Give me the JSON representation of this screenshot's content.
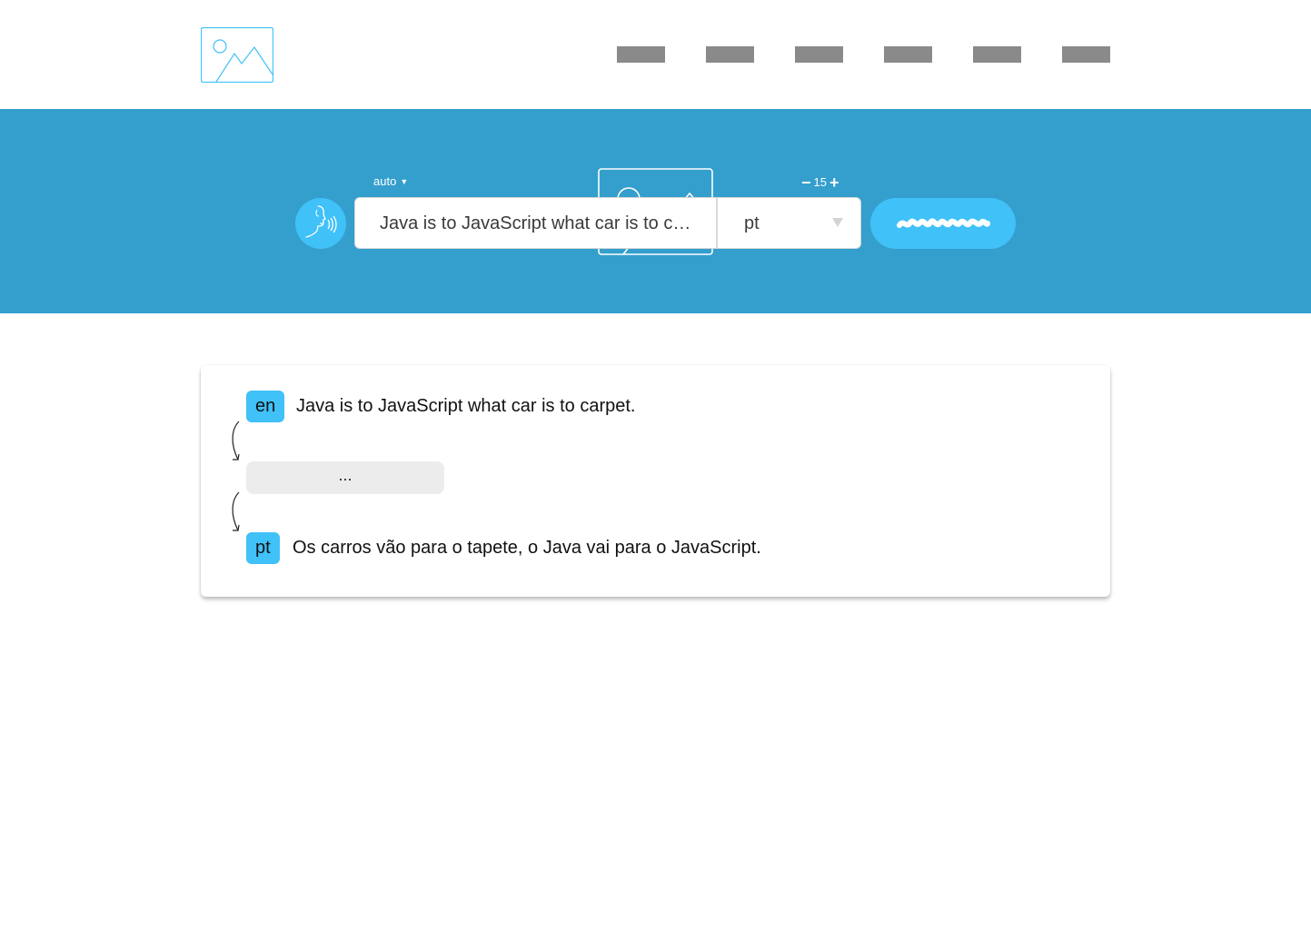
{
  "header": {
    "nav_items": [
      "",
      "",
      "",
      "",
      "",
      ""
    ]
  },
  "search": {
    "source_language": "auto",
    "query_value": "Java is to JavaScript what car is to carpet.",
    "target_language": "pt",
    "count": "15",
    "decrement_label": "−",
    "increment_label": "+"
  },
  "results": {
    "source": {
      "lang": "en",
      "text": "Java is to JavaScript what car is to carpet."
    },
    "intermediate": {
      "text": "..."
    },
    "target": {
      "lang": "pt",
      "text": "Os carros vão para o tapete, o Java vai para o JavaScript."
    }
  },
  "colors": {
    "hero_background": "#349fcd",
    "accent": "#40c1f8",
    "nav_placeholder": "#8a8a8a",
    "pending_background": "#ececec"
  },
  "icons": {
    "logo": "image-placeholder-icon",
    "mic": "speaking-head-icon",
    "dropdown": "caret-down-icon",
    "translate_button_label": "scribbled-placeholder-label"
  }
}
